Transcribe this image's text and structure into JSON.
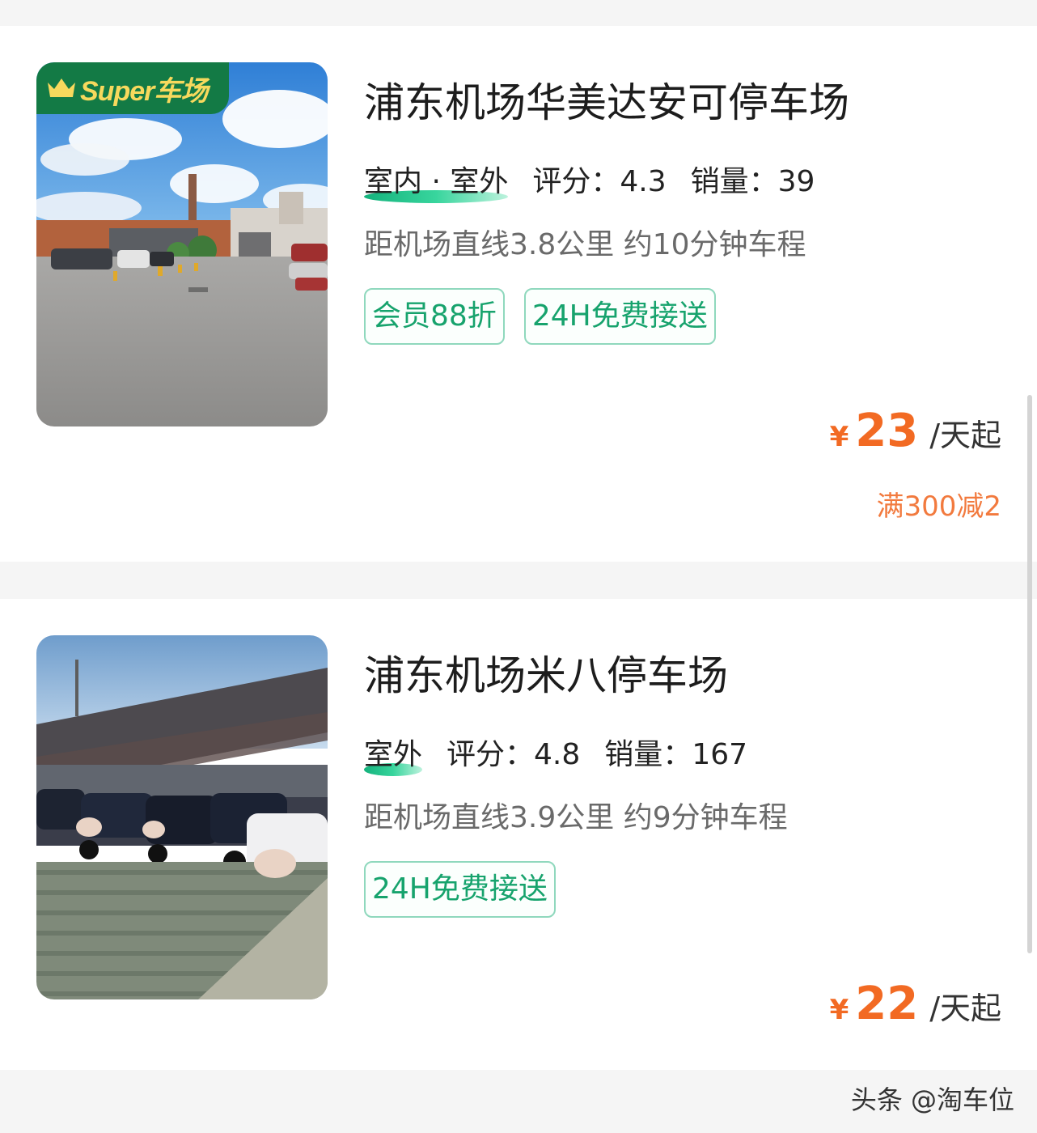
{
  "listings": [
    {
      "badge": "Super车场",
      "name": "浦东机场华美达安可停车场",
      "environment": "室内 · 室外",
      "rating_label": "评分：",
      "rating": "4.3",
      "sales_label": "销量：",
      "sales": "39",
      "distance": "距机场直线3.8公里 约10分钟车程",
      "tags": [
        "会员88折",
        "24H免费接送"
      ],
      "currency": "¥",
      "price": "23",
      "price_unit": "/天起",
      "promo": "满300减2"
    },
    {
      "name": "浦东机场米八停车场",
      "environment": "室外",
      "rating_label": "评分：",
      "rating": "4.8",
      "sales_label": "销量：",
      "sales": "167",
      "distance": "距机场直线3.9公里 约9分钟车程",
      "tags": [
        "24H免费接送"
      ],
      "currency": "¥",
      "price": "22",
      "price_unit": "/天起"
    }
  ],
  "watermark": "头条 @淘车位",
  "colors": {
    "accent_green": "#17a36d",
    "badge_green": "#137a45",
    "price_orange": "#f26a23"
  },
  "icons": [
    "crown-icon",
    "parking-lot-photo",
    "carport-photo"
  ]
}
